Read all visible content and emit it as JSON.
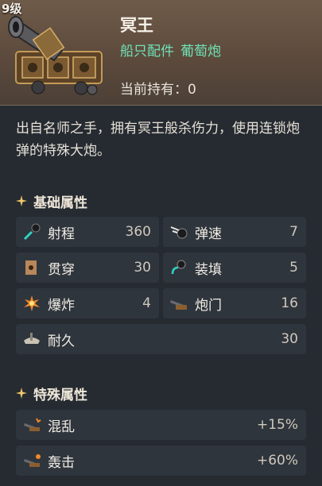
{
  "item": {
    "level": "9级",
    "name": "冥王",
    "category": "船只配件",
    "type": "葡萄炮",
    "holding_label": "当前持有",
    "holding_value": "0",
    "holding_text": "当前持有：0",
    "description": "出自名师之手，拥有冥王般杀伤力，使用连锁炮弹的特殊大炮。"
  },
  "basic": {
    "title": "基础属性",
    "stats": [
      {
        "icon": "range-icon",
        "label": "射程",
        "value": "360"
      },
      {
        "icon": "shell-speed-icon",
        "label": "弹速",
        "value": "7"
      },
      {
        "icon": "penetration-icon",
        "label": "贯穿",
        "value": "30"
      },
      {
        "icon": "reload-icon",
        "label": "装填",
        "value": "5"
      },
      {
        "icon": "explosion-icon",
        "label": "爆炸",
        "value": "4"
      },
      {
        "icon": "gun-port-icon",
        "label": "炮门",
        "value": "16"
      },
      {
        "icon": "durability-icon",
        "label": "耐久",
        "value": "30"
      }
    ]
  },
  "special": {
    "title": "特殊属性",
    "stats": [
      {
        "icon": "chaos-icon",
        "label": "混乱",
        "value": "+15%"
      },
      {
        "icon": "bombard-icon",
        "label": "轰击",
        "value": "+60%"
      }
    ]
  },
  "colors": {
    "accent_green": "#6fe2b6",
    "header_brown": "#6f5b49",
    "panel_bg": "#262b31",
    "row_bg": "#2f353c"
  }
}
